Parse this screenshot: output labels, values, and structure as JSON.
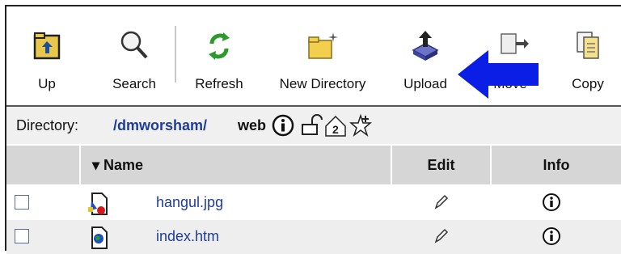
{
  "toolbar": {
    "buttons": [
      {
        "label": "Up",
        "icon": "folder-up-icon"
      },
      {
        "label": "Search",
        "icon": "magnifier-icon"
      },
      {
        "label": "Refresh",
        "icon": "refresh-icon"
      },
      {
        "label": "New Directory",
        "icon": "new-folder-icon"
      },
      {
        "label": "Upload",
        "icon": "upload-icon"
      },
      {
        "label": "Move",
        "icon": "move-icon"
      },
      {
        "label": "Copy",
        "icon": "copy-icon"
      }
    ]
  },
  "directory": {
    "label": "Directory:",
    "path_link": "/dmworsham/",
    "current": "web"
  },
  "table": {
    "columns": {
      "name": "▾ Name",
      "edit": "Edit",
      "info": "Info"
    },
    "rows": [
      {
        "name": "hangul.jpg",
        "icon": "image-file-icon"
      },
      {
        "name": "index.htm",
        "icon": "html-file-icon"
      }
    ]
  },
  "colors": {
    "link": "#1f3d99",
    "arrow": "#0a1ee6",
    "header_bg": "#d6d6d6"
  }
}
